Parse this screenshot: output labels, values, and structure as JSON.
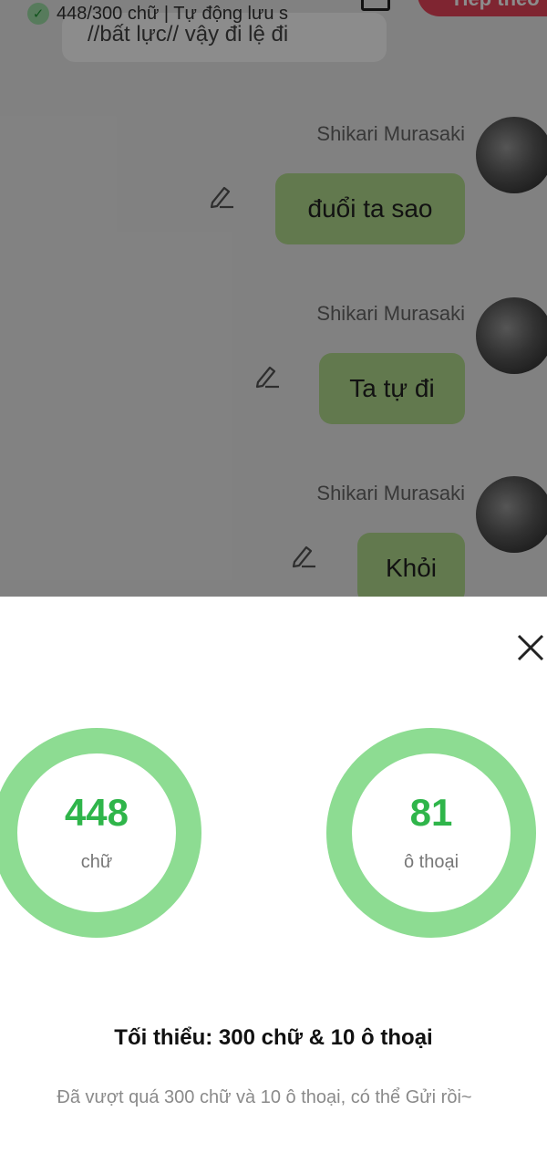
{
  "status": {
    "check_icon": "check-circle-icon",
    "text": "448/300 chữ | Tự động lưu s"
  },
  "header": {
    "action_button_label": "Tiếp theo"
  },
  "previous_message": {
    "text": "//bất lực// vậy đi lệ đi"
  },
  "messages": [
    {
      "name": "Shikari Murasaki",
      "text": "đuổi ta sao"
    },
    {
      "name": "Shikari Murasaki",
      "text": "Ta tự đi"
    },
    {
      "name": "Shikari Murasaki",
      "text": "Khỏi"
    }
  ],
  "stats": {
    "words": {
      "value": "448",
      "label": "chữ"
    },
    "dialogs": {
      "value": "81",
      "label": "ô thoại"
    }
  },
  "requirement": "Tối thiểu: 300 chữ & 10 ô thoại",
  "hint": "Đã vượt quá 300 chữ và 10 ô thoại, có thể Gửi rồi~",
  "colors": {
    "ring": "#8ddc92",
    "number": "#2fb54a",
    "bubble": "#b3dc8e",
    "accent": "#e8445a"
  }
}
